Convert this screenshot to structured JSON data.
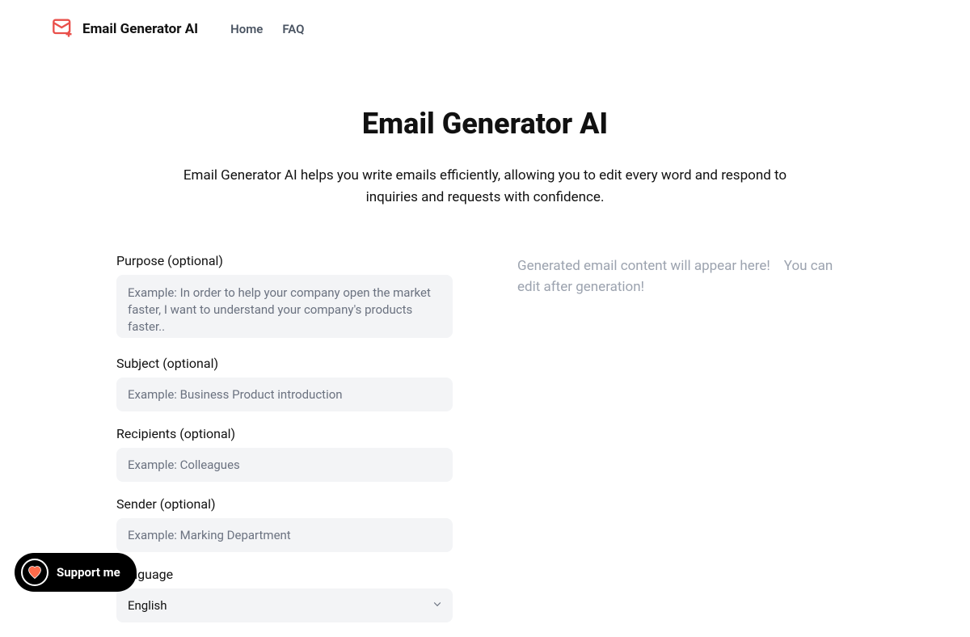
{
  "brand": "Email Generator AI",
  "nav": {
    "home": "Home",
    "faq": "FAQ"
  },
  "hero": {
    "title": "Email Generator AI",
    "description": "Email Generator AI helps you write emails efficiently, allowing you to edit every word and respond to inquiries and requests with confidence."
  },
  "form": {
    "purpose": {
      "label": "Purpose (optional)",
      "placeholder": "Example: In order to help your company open the market faster, I want to understand your company's products faster.."
    },
    "subject": {
      "label": "Subject (optional)",
      "placeholder": "Example: Business Product introduction"
    },
    "recipients": {
      "label": "Recipients (optional)",
      "placeholder": "Example: Colleagues"
    },
    "sender": {
      "label": "Sender (optional)",
      "placeholder": "Example: Marking Department"
    },
    "language": {
      "label": "Language",
      "value": "English"
    }
  },
  "output": {
    "placeholder": "Generated email content will appear here!　You can edit after generation!"
  },
  "support": {
    "label": "Support me"
  }
}
